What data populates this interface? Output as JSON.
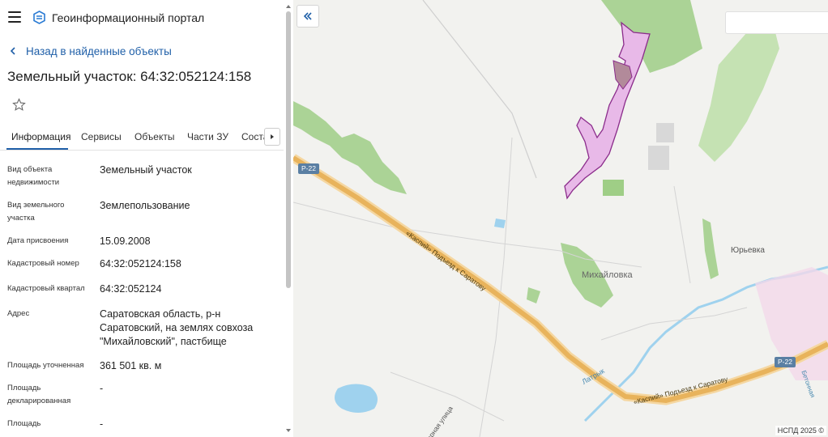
{
  "header": {
    "menu_icon": "hamburger-menu-icon",
    "logo_icon": "portal-logo-icon",
    "title": "Геоинформационный портал"
  },
  "navigation": {
    "back_label": "Назад в найденные объекты",
    "back_icon": "chevron-left-icon"
  },
  "object": {
    "title": "Земельный участок: 64:32:052124:158",
    "favorite_icon": "star-outline-icon"
  },
  "tabs": [
    {
      "label": "Информация",
      "active": true
    },
    {
      "label": "Сервисы",
      "active": false
    },
    {
      "label": "Объекты",
      "active": false
    },
    {
      "label": "Части ЗУ",
      "active": false
    },
    {
      "label": "Соста",
      "active": false
    }
  ],
  "tabs_next_icon": "caret-right-icon",
  "fields": [
    {
      "label": "Вид объекта недвижимости",
      "value": "Земельный участок"
    },
    {
      "label": "Вид земельного участка",
      "value": "Землепользование"
    },
    {
      "label": "Дата присвоения",
      "value": "15.09.2008"
    },
    {
      "label": "Кадастровый номер",
      "value": "64:32:052124:158"
    },
    {
      "label": "Кадастровый квартал",
      "value": "64:32:052124"
    },
    {
      "label": "Адрес",
      "value": "Саратовская область, р-н Саратовский, на землях совхоза \"Михайловский\", пастбище"
    },
    {
      "label": "Площадь уточненная",
      "value": "361 501 кв. м"
    },
    {
      "label": "Площадь декларированная",
      "value": "-"
    },
    {
      "label": "Площадь",
      "value": "-"
    }
  ],
  "map": {
    "collapse_icon": "double-chevron-left-icon",
    "search_placeholder": "",
    "labels": {
      "village_main": "Михайловка",
      "village_second": "Юрьевка",
      "road_number_1": "Р-22",
      "road_number_2": "Р-22",
      "road_name_1": "«Каспий» Подъезд к Саратову",
      "road_name_2": "«Каспий» Подъезд к Саратову",
      "river": "Латрык",
      "street": "Зарная улица",
      "road_side": "Бетонная"
    },
    "copyright": "НСПД 2025 ©",
    "colors": {
      "background": "#f2f2ef",
      "forest": "#9fce86",
      "parcel_fill": "#e8b9e8",
      "parcel_stroke": "#8b2c8b",
      "highway": "#e8b35c",
      "water": "#9fd2ee",
      "accent": "#1f5fa8"
    }
  }
}
